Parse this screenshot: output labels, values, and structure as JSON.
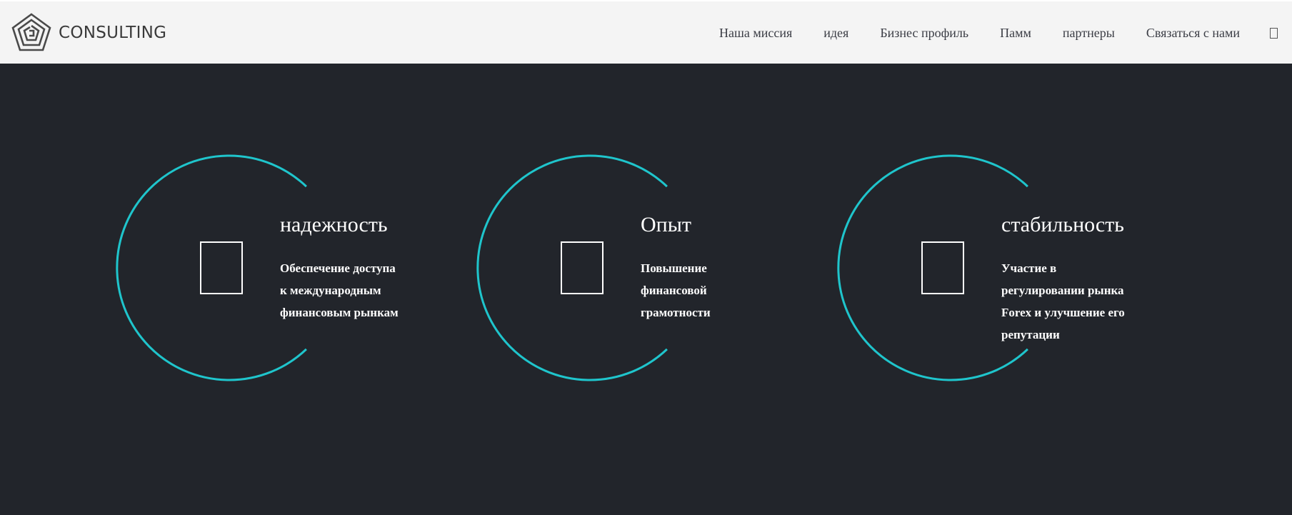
{
  "colors": {
    "header_bg": "#f4f4f4",
    "page_bg": "#22252b",
    "accent": "#1fc5cc",
    "nav_text": "#3b3d45"
  },
  "logo": {
    "text": "CONSULTING",
    "icon": "pentagon-maze-logo-icon"
  },
  "nav": {
    "items": [
      "Наша миссия",
      "идея",
      "Бизнес профиль",
      "Памм",
      "партнеры",
      "Связаться с нами"
    ],
    "extra_icon": "menu-toggle-icon"
  },
  "features": [
    {
      "title": "надежность",
      "icon": "missing-glyph-icon",
      "lines": [
        "Обеспечение доступа",
        "к международным",
        "финансовым рынкам"
      ]
    },
    {
      "title": "Опыт",
      "icon": "missing-glyph-icon",
      "lines": [
        "Повышение",
        "финансовой",
        "грамотности"
      ]
    },
    {
      "title": "стабильность",
      "icon": "missing-glyph-icon",
      "lines": [
        "Участие в",
        "регулировании рынка",
        "Forex и улучшение его",
        "репутации"
      ]
    }
  ]
}
